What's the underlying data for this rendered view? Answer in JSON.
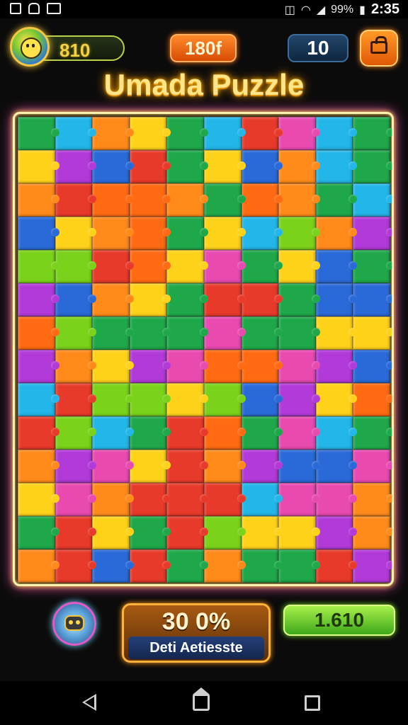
{
  "status_bar": {
    "battery_percent": "99%",
    "time": "2:35",
    "icons": [
      "image-icon",
      "android-icon",
      "gallery-icon",
      "vibrate-icon",
      "wifi-icon",
      "signal-icon",
      "battery-icon"
    ]
  },
  "hud": {
    "score": "810",
    "timer": "180f",
    "moves": "10",
    "shop_icon": "shop-basket-icon",
    "avatar_icon": "smiley-face-icon"
  },
  "title": "Umada Puzzle",
  "board": {
    "columns": 10,
    "rows": 14,
    "palette": [
      "#e83a2a",
      "#ff8a1a",
      "#ffd21a",
      "#7ad21a",
      "#1fa84a",
      "#23b6e8",
      "#2a6ad8",
      "#b23ad8",
      "#e84ab0",
      "#ff6a12"
    ]
  },
  "bottom": {
    "hint_icon": "robot-hint-icon",
    "progress_value": "30 0%",
    "progress_label": "Deti Aetiesste",
    "coins": "1.610"
  },
  "nav": {
    "icons": [
      "back-icon",
      "home-icon",
      "recent-apps-icon"
    ]
  }
}
